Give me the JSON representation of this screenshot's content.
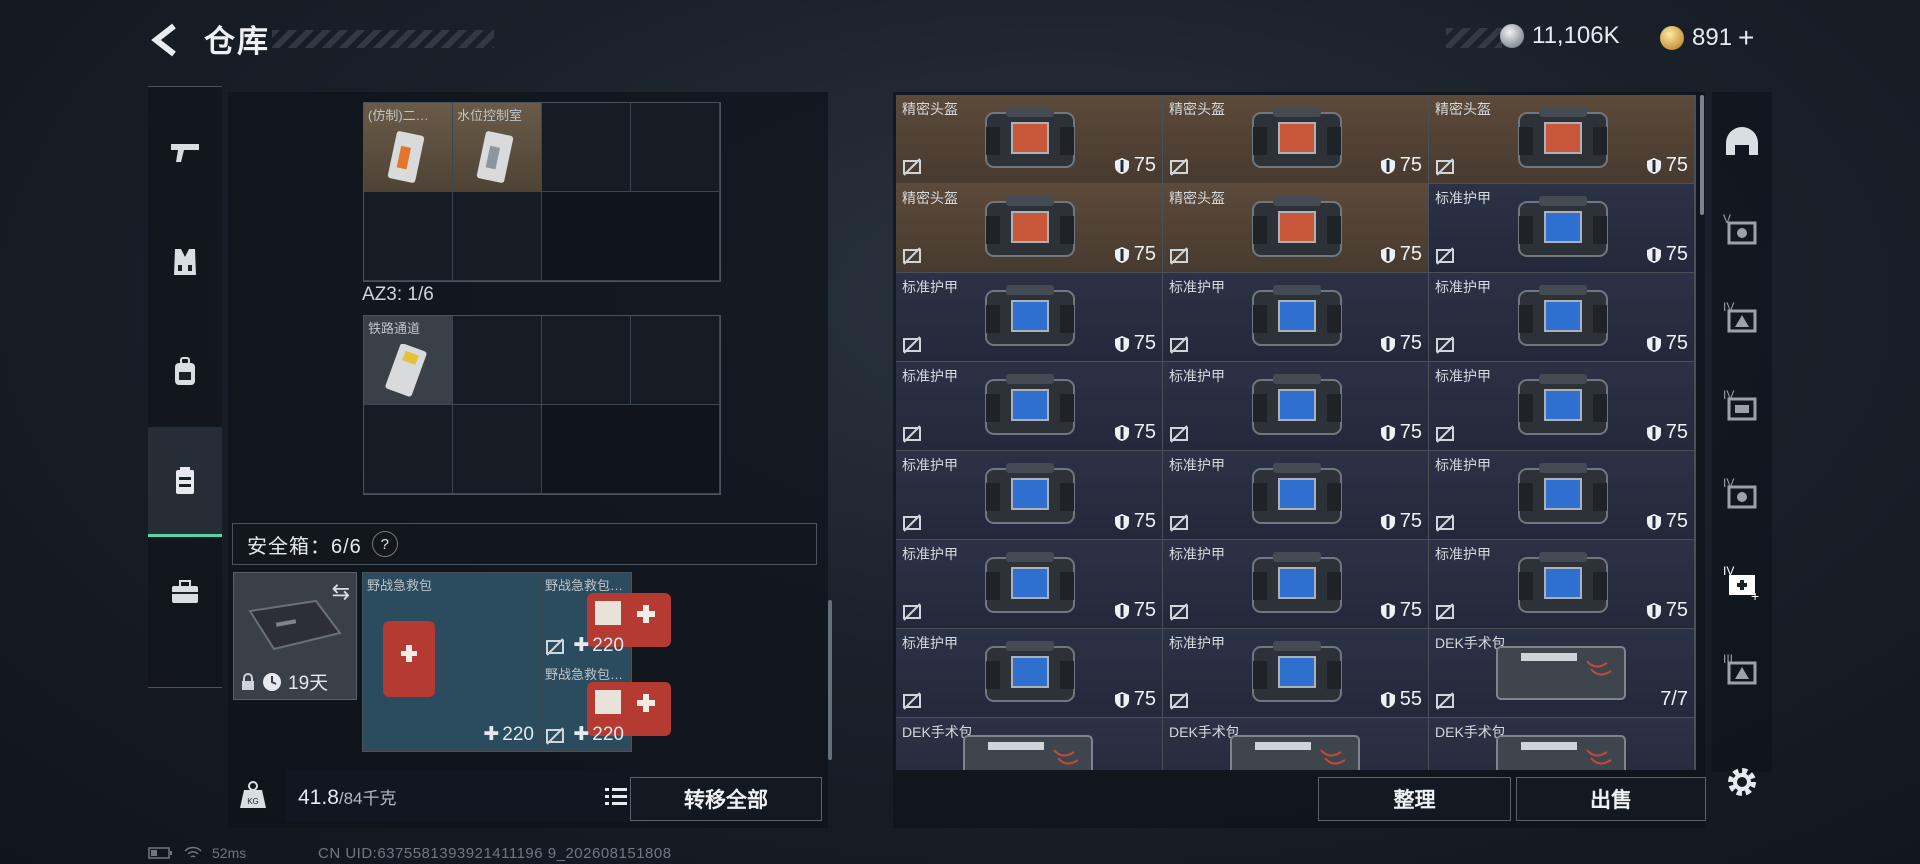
{
  "header": {
    "title": "仓库",
    "currency_silver": "11,106K",
    "currency_gold": "891",
    "gold_add": "+"
  },
  "colors": {
    "accent_green": "#55d6a8",
    "helmet_bg": "#5c4a3a",
    "armor_bg": "#2c3246"
  },
  "left_nav": {
    "items": [
      {
        "icon": "pistol-icon"
      },
      {
        "icon": "vest-icon"
      },
      {
        "icon": "backpack-icon"
      },
      {
        "icon": "container-icon",
        "active": true
      },
      {
        "icon": "toolbox-icon"
      }
    ]
  },
  "storage": {
    "grid1": [
      {
        "name": "(仿制)二…"
      },
      {
        "name": "水位控制室"
      }
    ],
    "az3_label": "AZ3: 1/6",
    "grid2": [
      {
        "name": "铁路通道"
      }
    ]
  },
  "safe_box": {
    "label": "安全箱：6/6",
    "help": "?",
    "timer": "19天",
    "items": [
      {
        "name": "野战急救包…",
        "value": "220"
      },
      {
        "name": "野战急救包",
        "value": "220"
      },
      {
        "name": "野战急救包…",
        "value": "220"
      }
    ]
  },
  "weight": {
    "current": "41.8",
    "max": "/84千克"
  },
  "buttons": {
    "transfer_all": "转移全部",
    "tidy": "整理",
    "sell": "出售"
  },
  "stash_items": [
    {
      "name": "精密头盔",
      "value": "75",
      "kind": "helm"
    },
    {
      "name": "精密头盔",
      "value": "75",
      "kind": "helm"
    },
    {
      "name": "精密头盔",
      "value": "75",
      "kind": "helm"
    },
    {
      "name": "精密头盔",
      "value": "75",
      "kind": "helm"
    },
    {
      "name": "精密头盔",
      "value": "75",
      "kind": "helm"
    },
    {
      "name": "标准护甲",
      "value": "75",
      "kind": "armor"
    },
    {
      "name": "标准护甲",
      "value": "75",
      "kind": "armor"
    },
    {
      "name": "标准护甲",
      "value": "75",
      "kind": "armor"
    },
    {
      "name": "标准护甲",
      "value": "75",
      "kind": "armor"
    },
    {
      "name": "标准护甲",
      "value": "75",
      "kind": "armor"
    },
    {
      "name": "标准护甲",
      "value": "75",
      "kind": "armor"
    },
    {
      "name": "标准护甲",
      "value": "75",
      "kind": "armor"
    },
    {
      "name": "标准护甲",
      "value": "75",
      "kind": "armor"
    },
    {
      "name": "标准护甲",
      "value": "75",
      "kind": "armor"
    },
    {
      "name": "标准护甲",
      "value": "75",
      "kind": "armor"
    },
    {
      "name": "标准护甲",
      "value": "75",
      "kind": "armor"
    },
    {
      "name": "标准护甲",
      "value": "75",
      "kind": "armor"
    },
    {
      "name": "标准护甲",
      "value": "75",
      "kind": "armor"
    },
    {
      "name": "标准护甲",
      "value": "75",
      "kind": "armor"
    },
    {
      "name": "标准护甲",
      "value": "55",
      "kind": "armor"
    },
    {
      "name": "DEK手术包",
      "value": "7/7",
      "kind": "kit"
    },
    {
      "name": "DEK手术包",
      "value": "",
      "kind": "kit"
    },
    {
      "name": "DEK手术包",
      "value": "",
      "kind": "kit"
    },
    {
      "name": "DEK手术包",
      "value": "",
      "kind": "kit"
    }
  ],
  "right_nav": {
    "items": [
      {
        "icon": "helmet-icon"
      },
      {
        "icon": "armor-tier5-icon"
      },
      {
        "icon": "armor-tier4a-icon"
      },
      {
        "icon": "armor-tier4b-icon"
      },
      {
        "icon": "armor-tier4c-icon"
      },
      {
        "icon": "medkit-tier4-icon"
      },
      {
        "icon": "armor-tier3-icon"
      }
    ]
  },
  "status": {
    "ping": "52ms",
    "uid": "CN UID:6375581393921411196 9_202608151808"
  }
}
